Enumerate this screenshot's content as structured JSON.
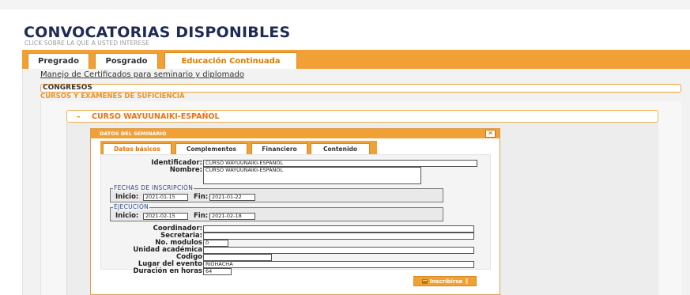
{
  "header": {
    "title": "CONVOCATORIAS DISPONIBLES",
    "subtitle": "CLICK SOBRE LA QUE A USTED INTERESE"
  },
  "tabs": [
    {
      "label": "Pregrado",
      "active": false
    },
    {
      "label": "Posgrado",
      "active": false
    },
    {
      "label": "Educación Continuada",
      "active": true
    }
  ],
  "cert_link": "Manejo de Certificados para seminario y diplomado",
  "accordion": {
    "congresos": "CONGRESOS",
    "cursos": "CURSOS Y EXAMENES DE SUFICIENCIA"
  },
  "course": {
    "toggle": "-",
    "title": "CURSO WAYUUNAIKI-ESPAÑOL"
  },
  "dialog": {
    "title": "DATOS DEL SEMINARIO",
    "close": "✕",
    "tabs": [
      "Datos básicos",
      "Complementos",
      "Financiero",
      "Contenido"
    ],
    "active_tab": "Datos básicos",
    "fields": {
      "identificador_label": "Identificador:",
      "identificador_value": "CURSO WAYUUNAIKI-ESPAÑOL",
      "nombre_label": "Nombre:",
      "nombre_value": "CURSO WAYUUNAIKI-ESPAÑOL",
      "inscripcion_legend": "FECHAS DE INSCRIPCIÓN",
      "inscripcion_inicio_label": "Inicio:",
      "inscripcion_inicio_value": "2021-01-15",
      "inscripcion_fin_label": "Fin:",
      "inscripcion_fin_value": "2021-01-22",
      "ejecucion_legend": "EJECUCIÓN",
      "ejecucion_inicio_label": "Inicio:",
      "ejecucion_inicio_value": "2021-02-15",
      "ejecucion_fin_label": "Fin:",
      "ejecucion_fin_value": "2021-02-18",
      "coordinador_label": "Coordinador:",
      "coordinador_value": "",
      "secretaria_label": "Secretaria:",
      "secretaria_value": "",
      "modulos_label": "No. modulos",
      "modulos_value": "0",
      "unidad_label": "Unidad académica",
      "unidad_value": "",
      "codigo_label": "Codigo",
      "codigo_value": "",
      "lugar_label": "Lugar del evento",
      "lugar_value": "RIOHACHA",
      "duracion_label": "Duración en horas",
      "duracion_value": "64"
    },
    "inscribirse_label": "Inscribirse"
  },
  "colors": {
    "accent": "#f0a035",
    "title": "#1f2a55",
    "active_tab_text": "#e07b00"
  },
  "icons": {
    "inscribirse": "edit-icon",
    "close": "close-icon"
  }
}
